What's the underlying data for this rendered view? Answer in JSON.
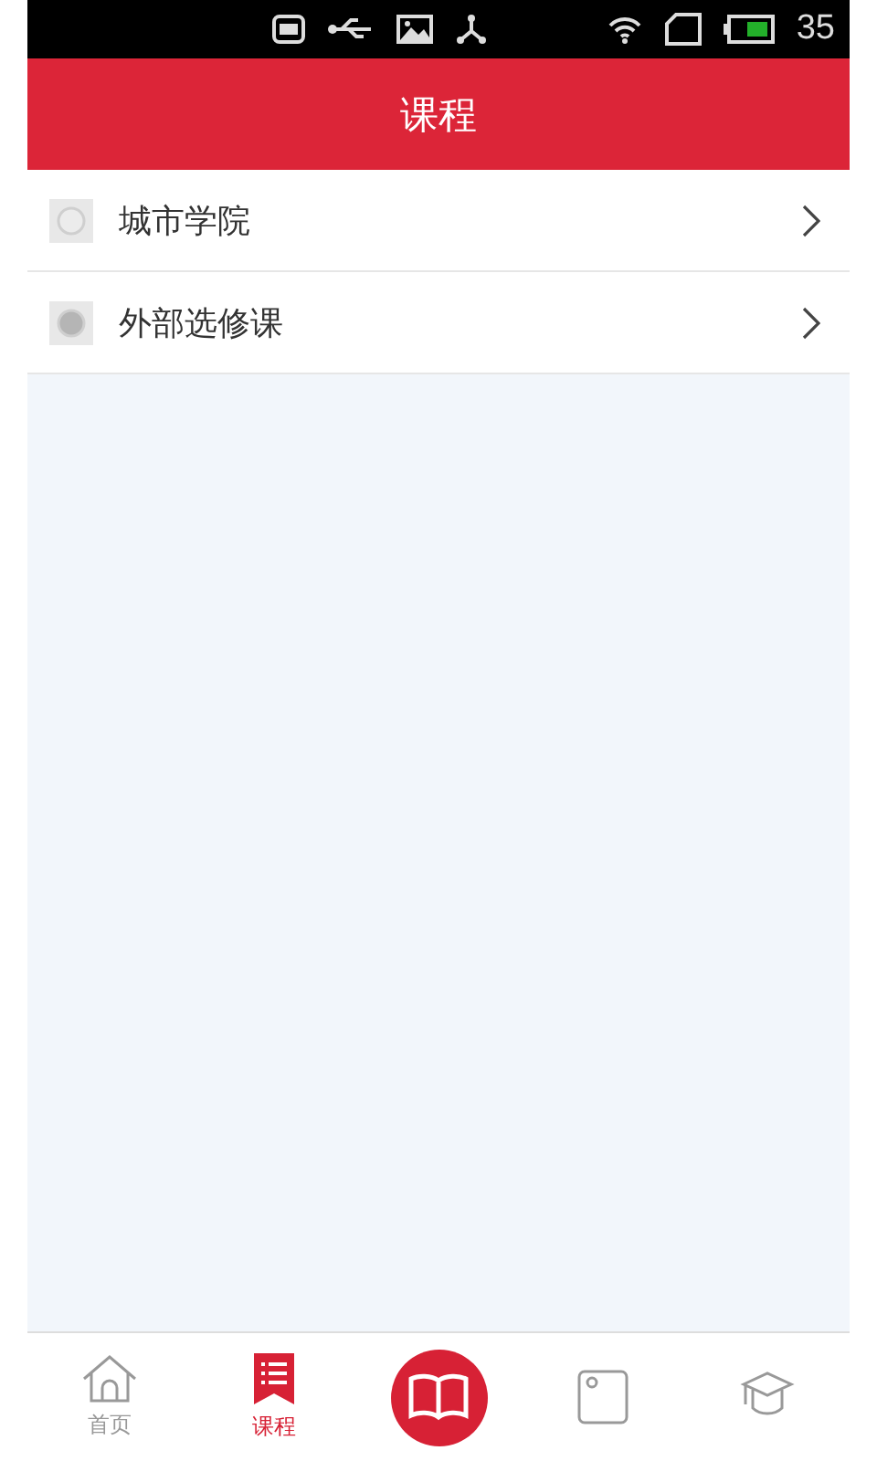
{
  "status_bar": {
    "battery": "35"
  },
  "header": {
    "title": "课程"
  },
  "list": [
    {
      "label": "城市学院"
    },
    {
      "label": "外部选修课"
    }
  ],
  "nav": [
    {
      "kind": "tab",
      "label": "首页",
      "selected": false
    },
    {
      "kind": "tab",
      "label": "课程",
      "selected": true
    },
    {
      "kind": "center",
      "selected": false
    },
    {
      "kind": "tab",
      "selected": false
    },
    {
      "kind": "tab",
      "selected": false
    }
  ]
}
